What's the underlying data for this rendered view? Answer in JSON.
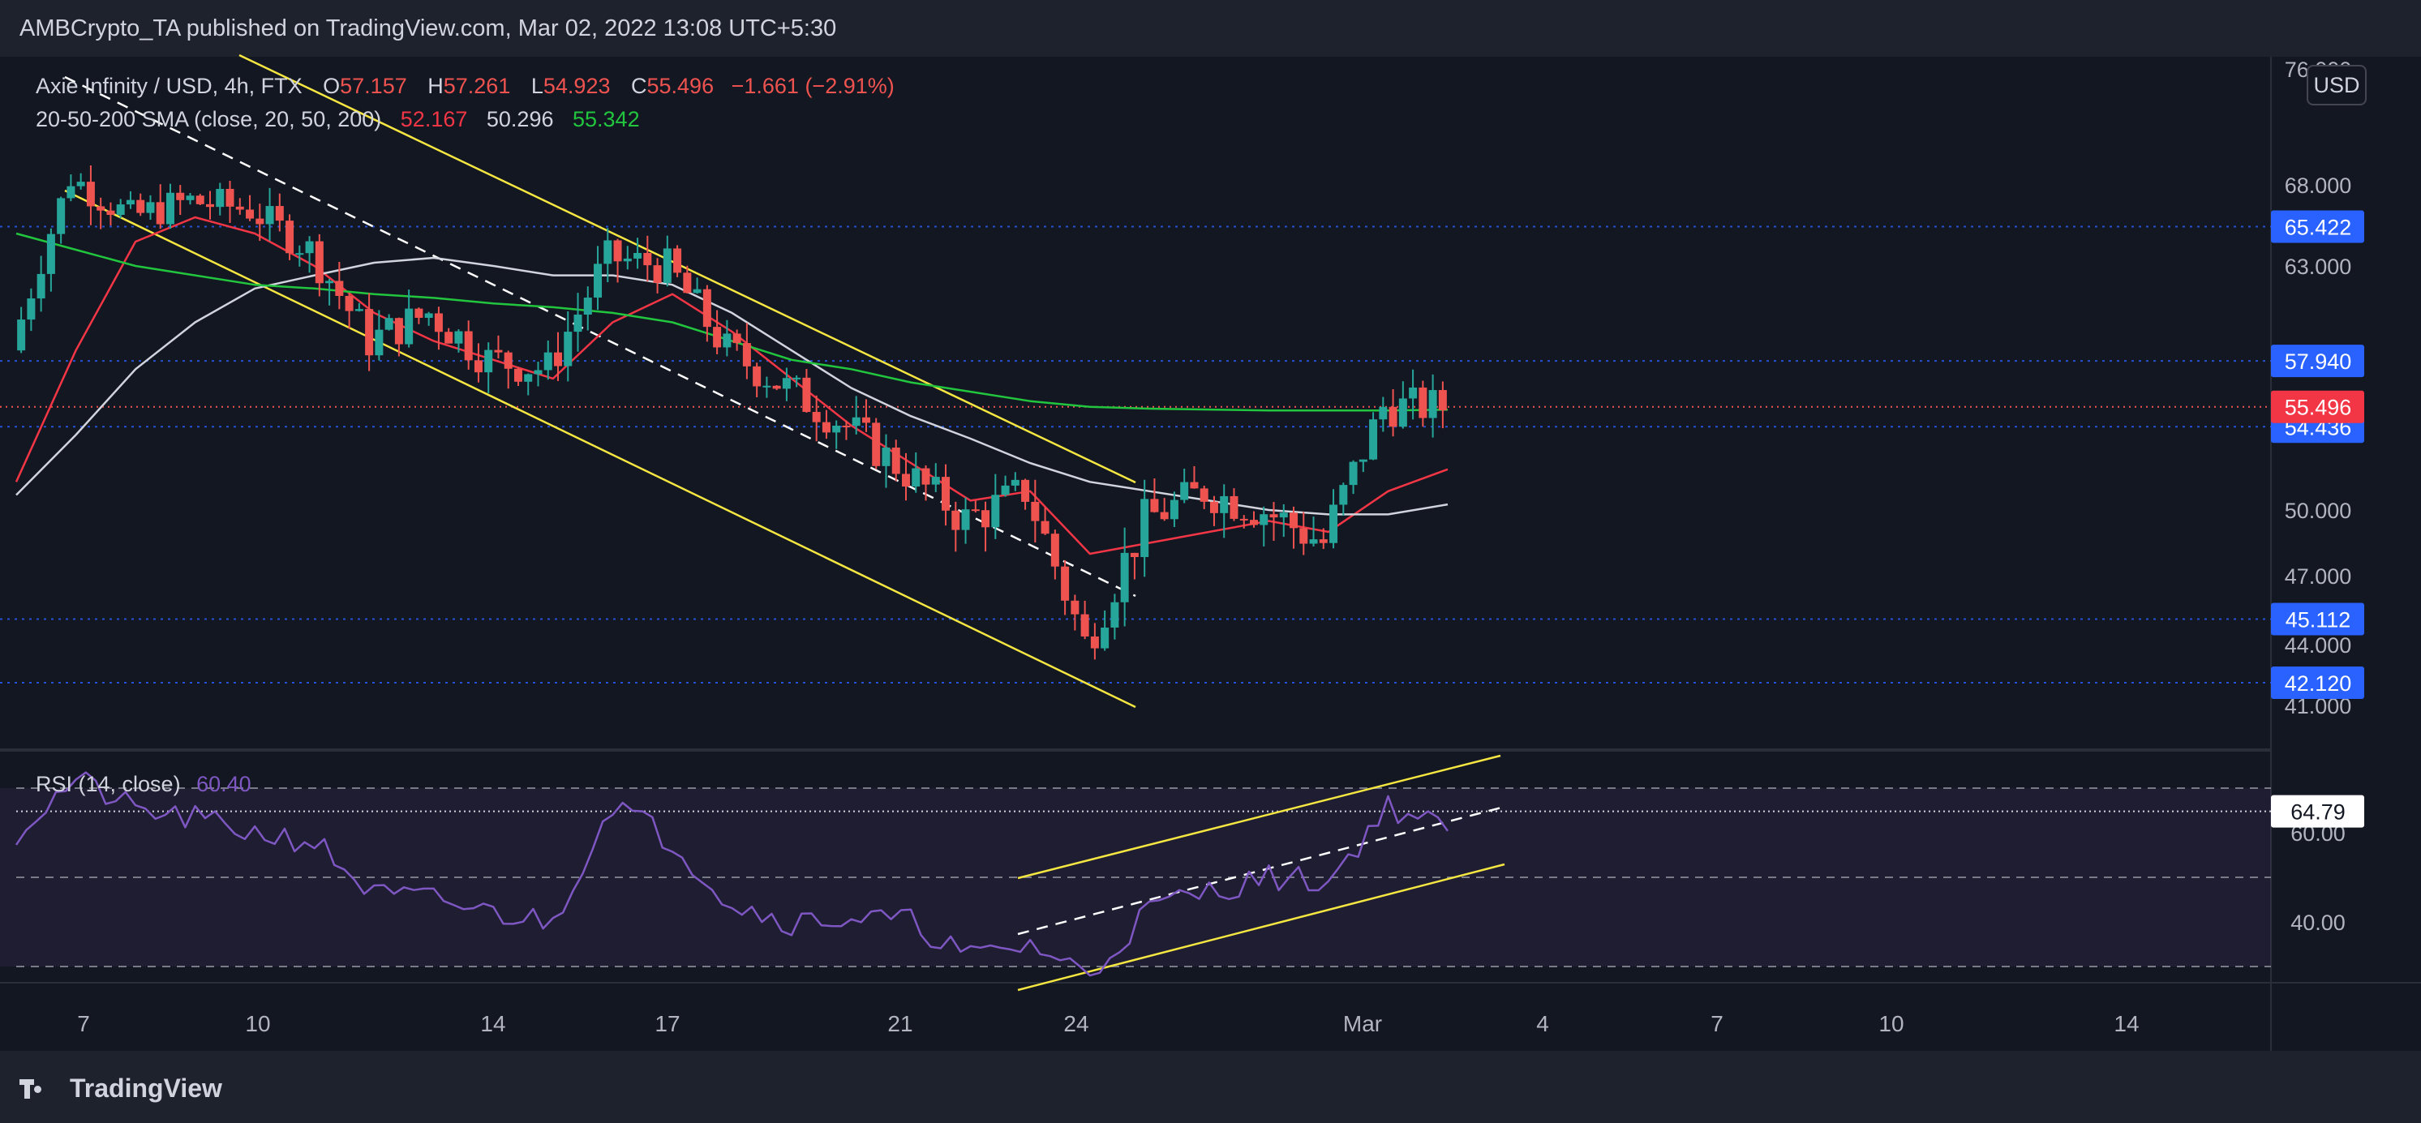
{
  "header": {
    "text": "AMBCrypto_TA published on TradingView.com, Mar 02, 2022 13:08 UTC+5:30"
  },
  "legend": {
    "symbol": "Axie Infinity / USD, 4h, FTX",
    "o_label": "O",
    "o_value": "57.157",
    "h_label": "H",
    "h_value": "57.261",
    "l_label": "L",
    "l_value": "54.923",
    "c_label": "C",
    "c_value": "55.496",
    "change": "−1.661 (−2.91%)",
    "sma_label": "20-50-200 SMA (close, 20, 50, 200)",
    "sma20_value": "52.167",
    "sma50_value": "50.296",
    "sma200_value": "55.342",
    "rsi_label": "RSI (14, close)",
    "rsi_value": "60.40"
  },
  "currency_button": "USD",
  "brand": "TradingView",
  "colors": {
    "up": "#26a69a",
    "down": "#ef5350",
    "sma20": "#f23645",
    "sma50": "#d1d4dc",
    "sma200": "#22c53e",
    "channel": "#f5e642",
    "rsi": "#7e57c2",
    "level_badge": "#2962ff",
    "last_badge": "#f23645"
  },
  "chart_data": [
    {
      "type": "line",
      "subtype": "candlestick",
      "series": [
        {
          "name": "Axie Infinity / USD, 4h, FTX",
          "kind": "candles",
          "x": [
            "Feb 6",
            "Feb 7",
            "Feb 8",
            "Feb 9",
            "Feb 10",
            "Feb 11",
            "Feb 12",
            "Feb 13",
            "Feb 14",
            "Feb 15",
            "Feb 16",
            "Feb 17",
            "Feb 18",
            "Feb 19",
            "Feb 20",
            "Feb 21",
            "Feb 22",
            "Feb 23",
            "Feb 24",
            "Feb 25",
            "Feb 26",
            "Feb 27",
            "Feb 28",
            "Mar 1",
            "Mar 2"
          ],
          "close": [
            58.5,
            68.5,
            66.0,
            67.0,
            66.5,
            64.0,
            59.0,
            60.5,
            58.0,
            57.5,
            63.5,
            63.0,
            58.5,
            56.5,
            54.5,
            52.0,
            49.5,
            51.0,
            44.0,
            49.5,
            51.0,
            50.0,
            48.5,
            55.5,
            55.496
          ]
        },
        {
          "name": "SMA 20",
          "values": [
            51.5,
            58.5,
            64.5,
            66.0,
            65.0,
            63.0,
            60.5,
            59.0,
            58.0,
            57.0,
            60.0,
            61.5,
            59.5,
            57.0,
            54.5,
            52.5,
            50.5,
            51.0,
            48.0,
            48.5,
            49.0,
            49.5,
            49.0,
            51.0,
            52.167
          ]
        },
        {
          "name": "SMA 50",
          "values": [
            50.8,
            54.0,
            57.5,
            60.0,
            61.8,
            62.5,
            63.2,
            63.5,
            63.0,
            62.5,
            62.5,
            62.0,
            60.5,
            58.5,
            56.5,
            55.0,
            53.8,
            52.5,
            51.5,
            51.0,
            50.5,
            50.0,
            49.8,
            49.8,
            50.296
          ]
        },
        {
          "name": "SMA 200",
          "values": [
            65.0,
            64.0,
            63.0,
            62.5,
            62.0,
            61.8,
            61.5,
            61.3,
            61.0,
            60.8,
            60.5,
            60.0,
            59.0,
            58.0,
            57.5,
            56.8,
            56.3,
            55.8,
            55.5,
            55.4,
            55.35,
            55.3,
            55.3,
            55.3,
            55.342
          ]
        }
      ],
      "levels": [
        65.422,
        57.94,
        54.436,
        45.112,
        42.12
      ],
      "last_price": 55.496,
      "y_ticks": [
        "76.000",
        "68.000",
        "63.000",
        "50.000",
        "47.000",
        "44.000",
        "41.000"
      ],
      "x_ticks": [
        "7",
        "10",
        "14",
        "17",
        "21",
        "24",
        "Mar",
        "4",
        "7",
        "10",
        "14"
      ],
      "ylim": [
        41,
        76
      ],
      "trendlines": "descending channel (yellow) with dashed white midline; price broke out above the upper boundary"
    },
    {
      "type": "line",
      "series": [
        {
          "name": "RSI (14, close)",
          "values": [
            60,
            72,
            65,
            63,
            60,
            58,
            46,
            45,
            42,
            40,
            67,
            58,
            44,
            40,
            41,
            40,
            32,
            35,
            28,
            43,
            47,
            50,
            49,
            66,
            60.4
          ]
        }
      ],
      "last_value": 64.79,
      "y_ticks": [
        "60.00",
        "40.00"
      ],
      "bands": [
        30,
        50,
        70
      ],
      "ylim": [
        25,
        80
      ],
      "trendlines": "ascending channel (yellow) with dashed white midline"
    }
  ]
}
